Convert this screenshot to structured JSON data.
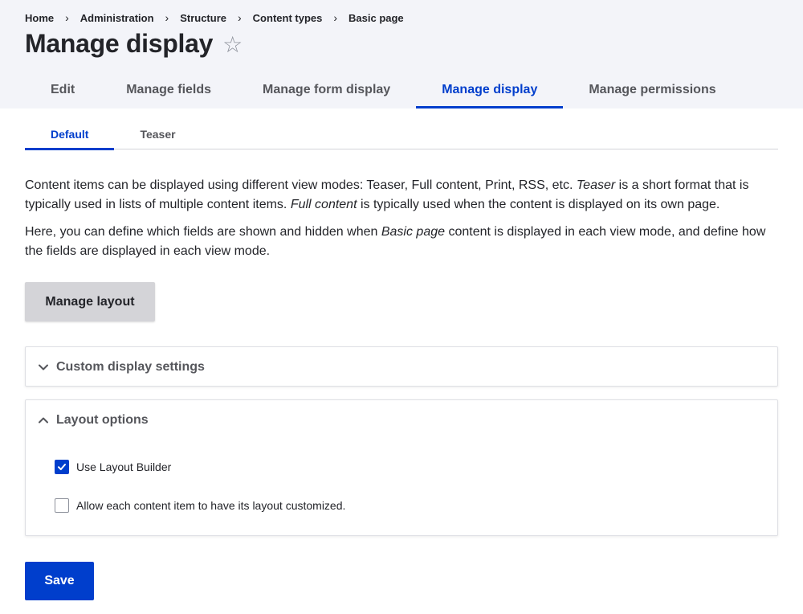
{
  "breadcrumb": [
    "Home",
    "Administration",
    "Structure",
    "Content types",
    "Basic page"
  ],
  "breadcrumb_separator": "›",
  "page_title": "Manage display",
  "favorite_glyph": "☆",
  "primary_tabs": [
    {
      "label": "Edit",
      "active": false
    },
    {
      "label": "Manage fields",
      "active": false
    },
    {
      "label": "Manage form display",
      "active": false
    },
    {
      "label": "Manage display",
      "active": true
    },
    {
      "label": "Manage permissions",
      "active": false
    }
  ],
  "secondary_tabs": [
    {
      "label": "Default",
      "active": true
    },
    {
      "label": "Teaser",
      "active": false
    }
  ],
  "description": {
    "p1_a": "Content items can be displayed using different view modes: Teaser, Full content, Print, RSS, etc. ",
    "p1_em1": "Teaser",
    "p1_b": " is a short format that is typically used in lists of multiple content items. ",
    "p1_em2": "Full content",
    "p1_c": " is typically used when the content is displayed on its own page.",
    "p2_a": "Here, you can define which fields are shown and hidden when ",
    "p2_em": "Basic page",
    "p2_b": " content is displayed in each view mode, and define how the fields are displayed in each view mode."
  },
  "manage_layout_label": "Manage layout",
  "custom_display_settings": {
    "label": "Custom display settings",
    "expanded": false
  },
  "layout_options": {
    "label": "Layout options",
    "expanded": true,
    "use_layout_builder": {
      "label": "Use Layout Builder",
      "checked": true
    },
    "allow_customize": {
      "label": "Allow each content item to have its layout customized.",
      "checked": false
    }
  },
  "save_label": "Save",
  "colors": {
    "accent": "#003ecc",
    "header_bg": "#f3f4f9",
    "button_gray": "#d4d4d8"
  },
  "icons": {
    "star": "star-outline-icon",
    "collapsed": "chevron-down-icon",
    "expanded": "chevron-up-icon",
    "check": "checkmark-icon"
  }
}
